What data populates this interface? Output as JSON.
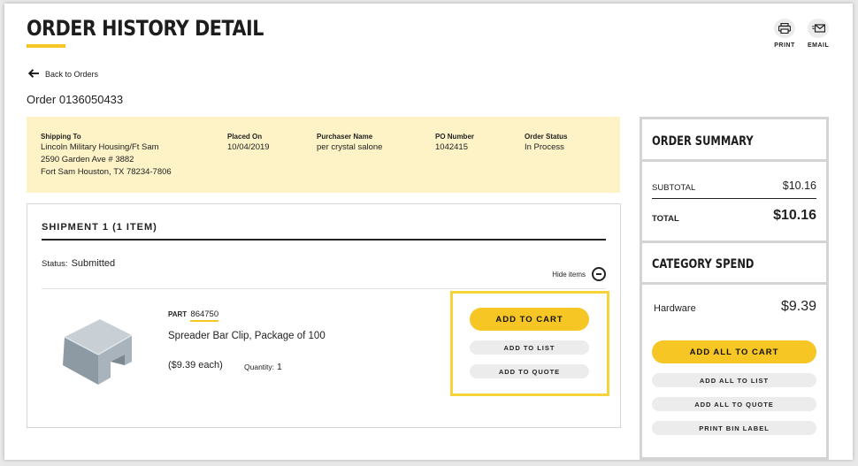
{
  "header": {
    "title": "ORDER HISTORY DETAIL",
    "print_label": "PRINT",
    "email_label": "EMAIL"
  },
  "nav": {
    "back_label": "Back to Orders"
  },
  "order": {
    "number_text": "Order 0136050433"
  },
  "shipping_info": {
    "shipping_to_label": "Shipping To",
    "address_line1": "Lincoln Military Housing/Ft Sam",
    "address_line2": "2590 Garden Ave # 3882",
    "address_line3": "Fort Sam Houston, TX 78234-7806",
    "placed_on_label": "Placed On",
    "placed_on": "10/04/2019",
    "purchaser_label": "Purchaser Name",
    "purchaser": "per crystal salone",
    "po_label": "PO Number",
    "po": "1042415",
    "status_label": "Order Status",
    "status": "In Process"
  },
  "shipment": {
    "title": "SHIPMENT 1 (1 ITEM)",
    "status_label": "Status:",
    "status": "Submitted",
    "hide_items_label": "Hide items",
    "item": {
      "part_label": "PART",
      "part_number": "864750",
      "name": "Spreader Bar Clip, Package of 100",
      "price": "($9.39 each)",
      "quantity_label": "Quantity:",
      "quantity": "1",
      "add_to_cart": "ADD TO CART",
      "add_to_list": "ADD TO LIST",
      "add_to_quote": "ADD TO QUOTE"
    }
  },
  "summary": {
    "title": "ORDER SUMMARY",
    "subtotal_label": "SUBTOTAL",
    "subtotal": "$10.16",
    "total_label": "TOTAL",
    "total": "$10.16",
    "category_title": "CATEGORY SPEND",
    "category_name": "Hardware",
    "category_amount": "$9.39",
    "add_all_cart": "ADD ALL TO CART",
    "add_all_list": "ADD ALL TO LIST",
    "add_all_quote": "ADD ALL TO QUOTE",
    "print_bin": "PRINT BIN LABEL"
  },
  "colors": {
    "accent": "#f6c624",
    "info_bg": "#fdf3c7",
    "button_gray": "#ececec"
  },
  "icons": [
    "printer-icon",
    "email-icon",
    "arrow-left-icon",
    "minus-circle-icon"
  ]
}
